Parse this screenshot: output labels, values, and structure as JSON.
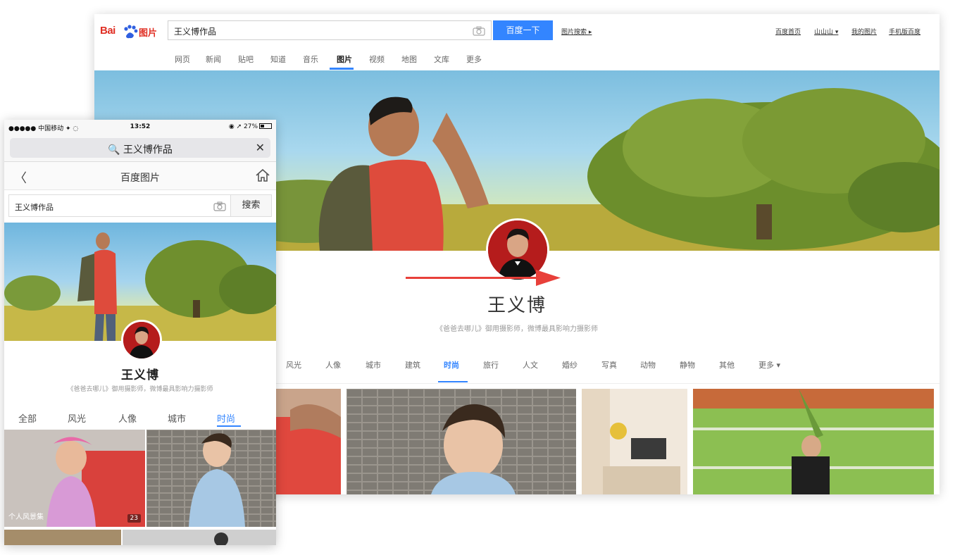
{
  "desktop": {
    "logo": {
      "bai": "Bai",
      "pic": "图片"
    },
    "search": {
      "query": "王义博作品",
      "button": "百度一下"
    },
    "advanced_link": "图片搜索 ▸",
    "top_links": [
      "百度首页",
      "山山山 ▾",
      "我的图片",
      "手机版百度"
    ],
    "nav": [
      "网页",
      "新闻",
      "贴吧",
      "知道",
      "音乐",
      "图片",
      "视频",
      "地图",
      "文库",
      "更多"
    ],
    "nav_active": "图片",
    "profile": {
      "name": "王义博",
      "desc": "《爸爸去哪儿》御用摄影师，微博最具影响力摄影师"
    },
    "categories": [
      "风光",
      "人像",
      "城市",
      "建筑",
      "时尚",
      "旅行",
      "人文",
      "婚纱",
      "写真",
      "动物",
      "静物",
      "其他",
      "更多 ▾"
    ],
    "category_active": "时尚"
  },
  "mobile": {
    "status": {
      "carrier": "●●●●● 中国移动 ✦ ◌",
      "time": "13:52",
      "right": "◉ ➚ 27%"
    },
    "url_query": "🔍 王义博作品",
    "close": "✕",
    "header": {
      "back": "〈",
      "title": "百度图片"
    },
    "search": {
      "query": "王义博作品",
      "button": "搜索"
    },
    "profile": {
      "name": "王义博",
      "desc": "《爸爸去哪儿》御用摄影师，微博最具影响力摄影师"
    },
    "categories": [
      "全部",
      "风光",
      "人像",
      "城市",
      "时尚"
    ],
    "category_active": "时尚",
    "tile1": {
      "caption": "个人风景集",
      "count": "23"
    }
  },
  "colors": {
    "accent": "#3385ff",
    "brand_red": "#e02f24",
    "arrow_red": "#e8403a"
  }
}
